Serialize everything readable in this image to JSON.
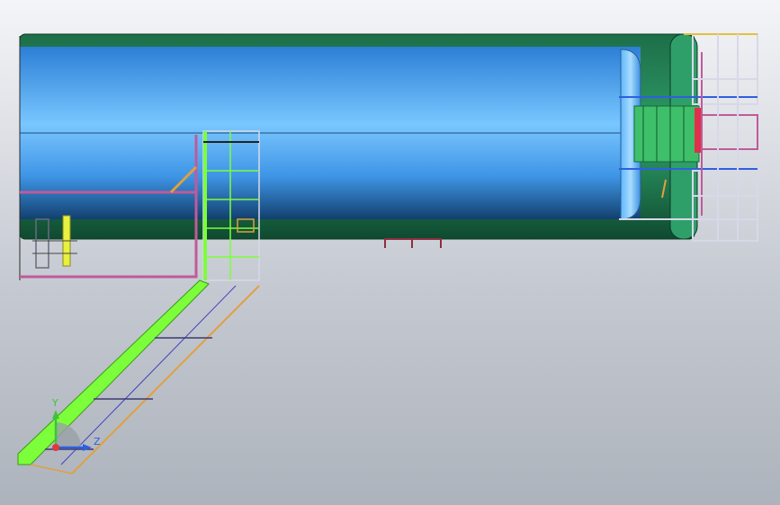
{
  "viewport": {
    "background_top": "#f4f5f8",
    "background_bottom": "#adb3bc"
  },
  "model": {
    "vessel_color": "#3f95e6",
    "vessel_highlight": "#79c7ff",
    "jacket_color": "#1f7a52",
    "head_color": "#2a8f60",
    "walkway_color": "#c05a9a",
    "stair_stringer_color": "#7cff3a",
    "handrail_color": "#e0a040",
    "ladder_color": "#6aff6a",
    "platform_frame_color": "#d8d8e8"
  },
  "triad": {
    "y_label": "Y",
    "z_label": "Z",
    "y_color": "#3fc23f",
    "z_color": "#2f5fe0",
    "x_color": "#e03a3a"
  }
}
